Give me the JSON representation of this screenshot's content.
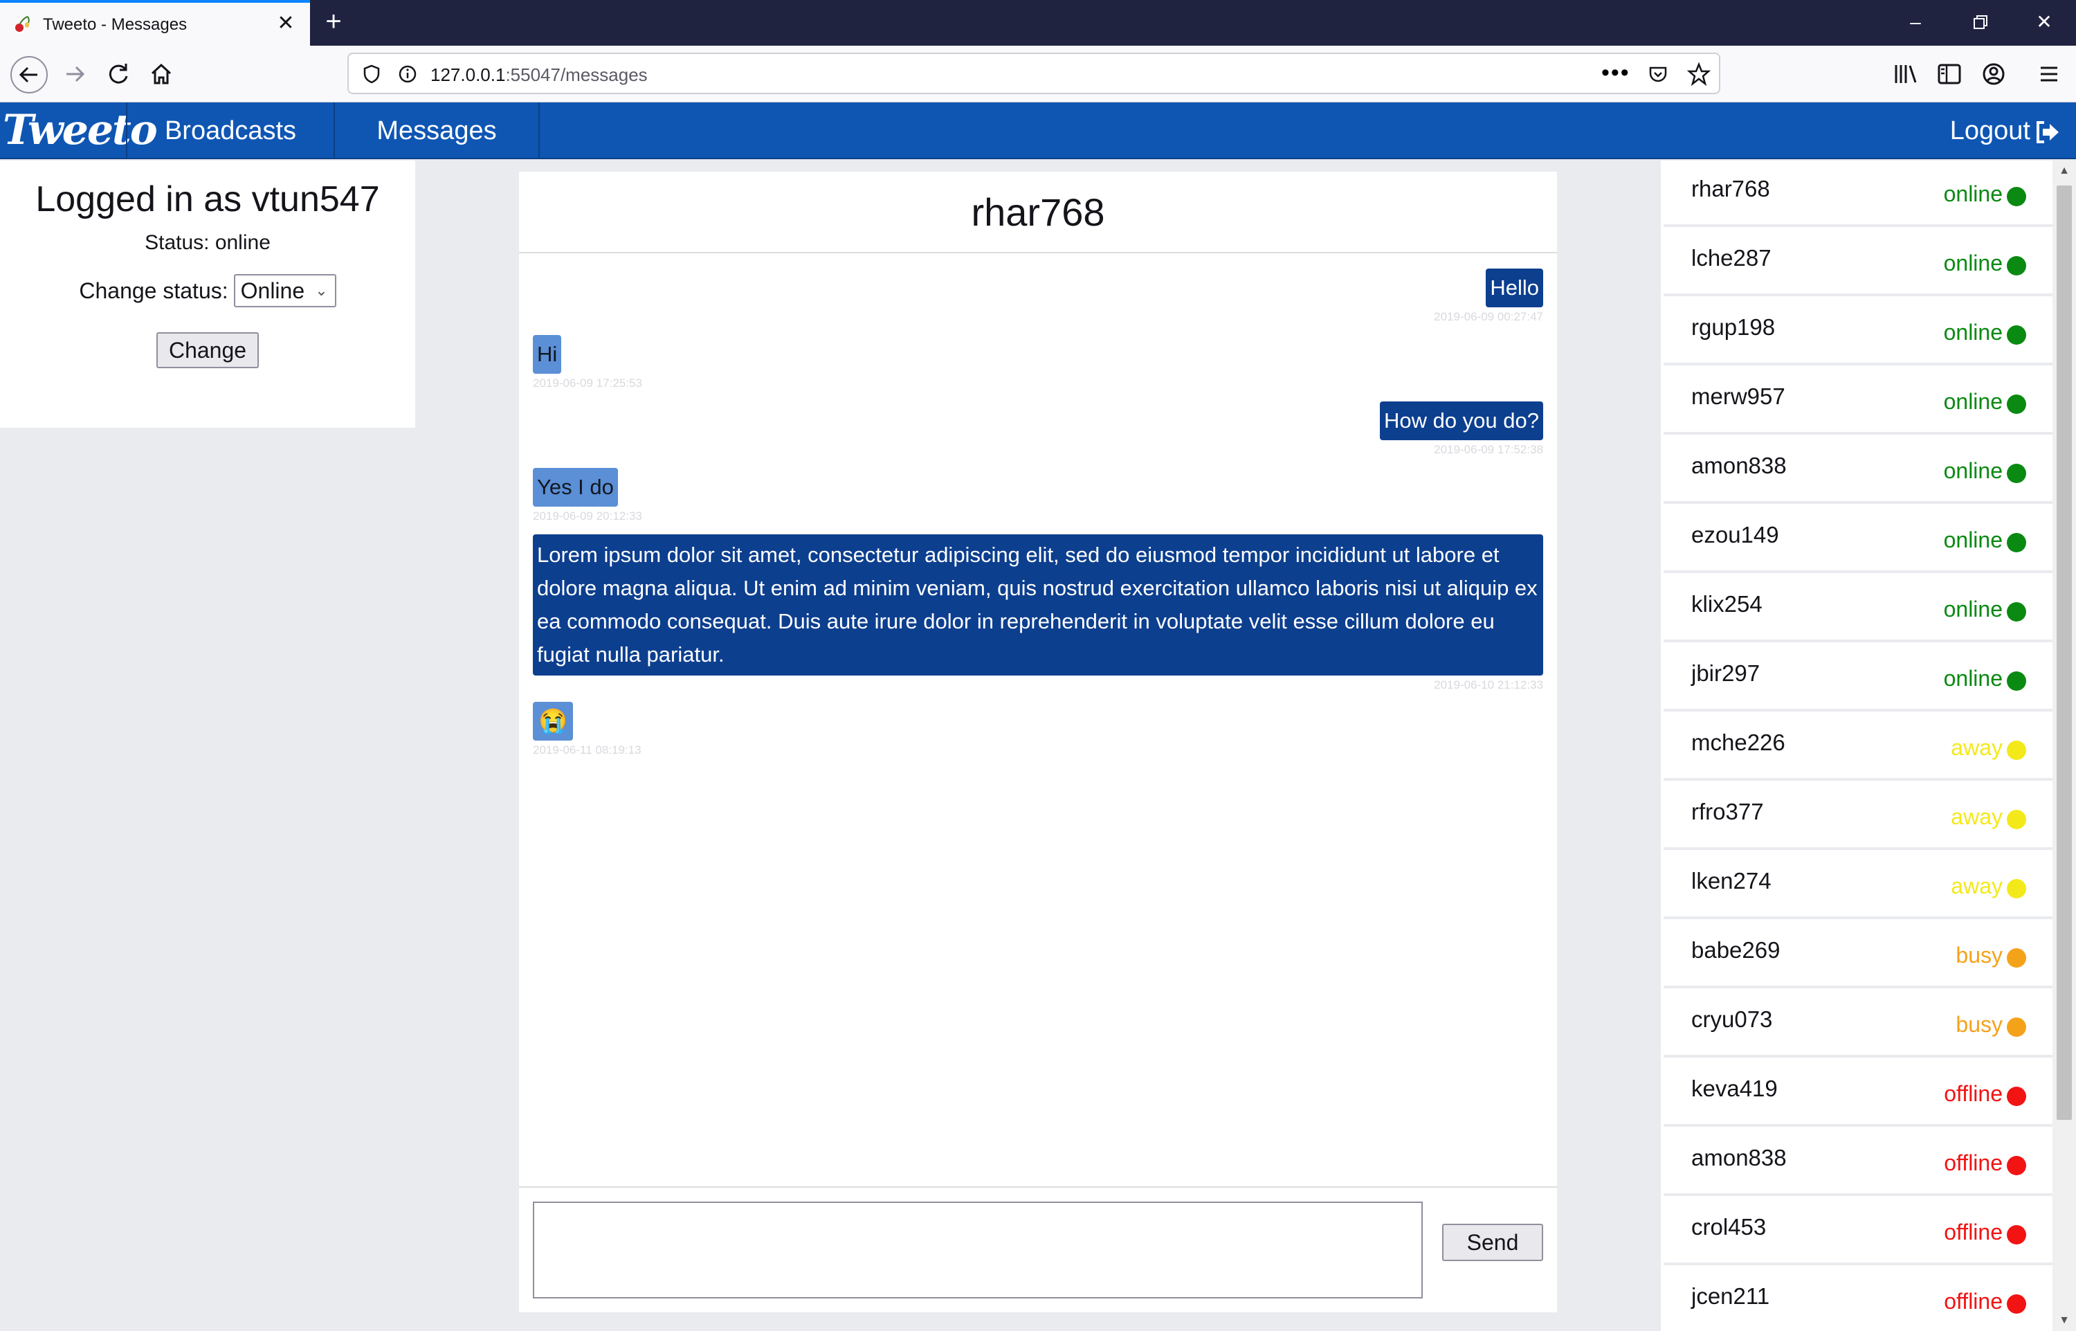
{
  "browser": {
    "tab_title": "Tweeto - Messages",
    "url_host": "127.0.0.1",
    "url_rest": ":55047/messages"
  },
  "app": {
    "logo": "Tweeto",
    "nav": [
      "Broadcasts",
      "Messages"
    ],
    "logout": "Logout"
  },
  "profile": {
    "logged_in": "Logged in as vtun547",
    "status": "Status: online",
    "change_label": "Change status:",
    "selected_status": "Online",
    "change_button": "Change"
  },
  "chat": {
    "partner": "rhar768",
    "messages": [
      {
        "dir": "out",
        "text": "Hello",
        "time": "2019-06-09 00:27:47"
      },
      {
        "dir": "in",
        "text": "Hi",
        "time": "2019-06-09 17:25:53"
      },
      {
        "dir": "out",
        "text": "How do you do?",
        "time": "2019-06-09 17:52:38"
      },
      {
        "dir": "in",
        "text": "Yes I do",
        "time": "2019-06-09 20:12:33"
      },
      {
        "dir": "out",
        "text": "Lorem ipsum dolor sit amet, consectetur adipiscing elit, sed do eiusmod tempor incididunt ut labore et dolore magna aliqua. Ut enim ad minim veniam, quis nostrud exercitation ullamco laboris nisi ut aliquip ex ea commodo consequat. Duis aute irure dolor in reprehenderit in voluptate velit esse cillum dolore eu fugiat nulla pariatur.",
        "time": "2019-06-10 21:12:33"
      },
      {
        "dir": "in",
        "text": "😭",
        "time": "2019-06-11 08:19:13"
      }
    ],
    "send_button": "Send"
  },
  "users": [
    {
      "name": "rhar768",
      "status": "online"
    },
    {
      "name": "lche287",
      "status": "online"
    },
    {
      "name": "rgup198",
      "status": "online"
    },
    {
      "name": "merw957",
      "status": "online"
    },
    {
      "name": "amon838",
      "status": "online"
    },
    {
      "name": "ezou149",
      "status": "online"
    },
    {
      "name": "klix254",
      "status": "online"
    },
    {
      "name": "jbir297",
      "status": "online"
    },
    {
      "name": "mche226",
      "status": "away"
    },
    {
      "name": "rfro377",
      "status": "away"
    },
    {
      "name": "lken274",
      "status": "away"
    },
    {
      "name": "babe269",
      "status": "busy"
    },
    {
      "name": "cryu073",
      "status": "busy"
    },
    {
      "name": "keva419",
      "status": "offline"
    },
    {
      "name": "amon838",
      "status": "offline"
    },
    {
      "name": "crol453",
      "status": "offline"
    },
    {
      "name": "jcen211",
      "status": "offline"
    }
  ],
  "status_colors": {
    "online": "#0a8a12",
    "away": "#f3e91a",
    "busy": "#f5a21b",
    "offline": "#f21313"
  },
  "icons": [
    "back-icon",
    "forward-icon",
    "reload-icon",
    "home-icon",
    "shield-icon",
    "info-icon",
    "more-icon",
    "pocket-icon",
    "star-icon",
    "library-icon",
    "sidebar-icon",
    "account-icon",
    "menu-icon",
    "logout-icon"
  ]
}
